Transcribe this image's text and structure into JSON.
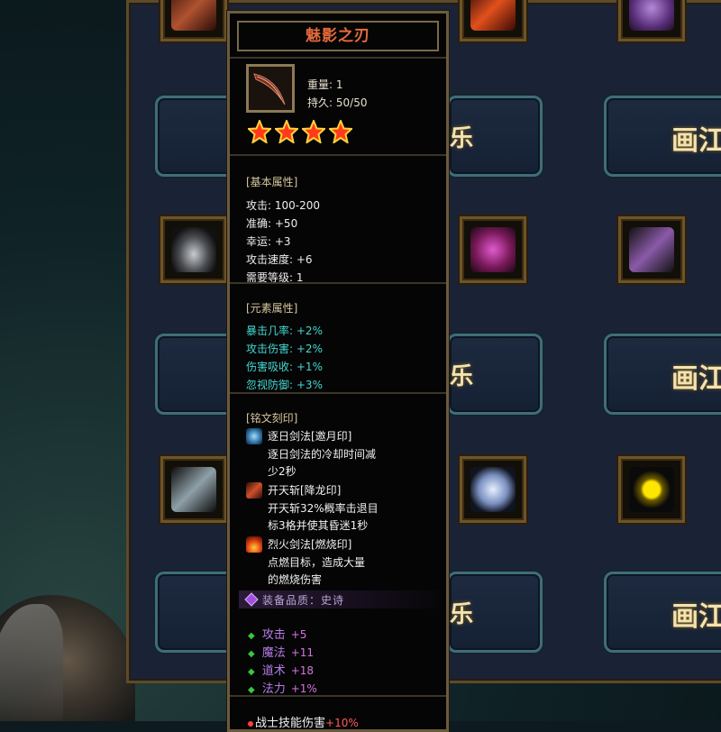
{
  "background": {
    "plaque_text": "画江",
    "plaque_fragment_left": "画",
    "plaque_fragment_right": "乐"
  },
  "tooltip": {
    "title": "魅影之刃",
    "weight_label": "重量:",
    "weight_value": "1",
    "durability_label": "持久:",
    "durability_value": "50/50",
    "star_count": 4,
    "basic": {
      "heading": "[基本属性]",
      "rows": [
        {
          "label": "攻击:",
          "value": "100-200"
        },
        {
          "label": "准确:",
          "value": "+50"
        },
        {
          "label": "幸运:",
          "value": "+3"
        },
        {
          "label": "攻击速度:",
          "value": "+6"
        },
        {
          "label": "需要等级:",
          "value": "1"
        }
      ]
    },
    "element": {
      "heading": "[元素属性]",
      "rows": [
        {
          "label": "暴击几率:",
          "value": "+2%"
        },
        {
          "label": "攻击伤害:",
          "value": "+2%"
        },
        {
          "label": "伤害吸收:",
          "value": "+1%"
        },
        {
          "label": "忽视防御:",
          "value": "+3%"
        }
      ]
    },
    "inscription": {
      "heading": "[铭文刻印]",
      "items": [
        {
          "icon": "moon-seal-icon",
          "name": "逐日剑法[邀月印]",
          "line1": "逐日剑法的冷却时间减",
          "line2": "少2秒"
        },
        {
          "icon": "dragon-seal-icon",
          "name": "开天斩[降龙印]",
          "line1": "开天斩32%概率击退目",
          "line2": "标3格并使其昏迷1秒"
        },
        {
          "icon": "fire-seal-icon",
          "name": "烈火剑法[燃烧印]",
          "line1": "点燃目标，造成大量",
          "line2": "的燃烧伤害"
        }
      ]
    },
    "quality": "装备品质：史诗",
    "bonuses": [
      {
        "label": "攻击",
        "value": "+5"
      },
      {
        "label": "魔法",
        "value": "+11"
      },
      {
        "label": "道术",
        "value": "+18"
      },
      {
        "label": "法力",
        "value": "+1%"
      }
    ],
    "skill_label": "战士技能伤害",
    "skill_value": "+10%"
  },
  "colors": {
    "title": "#e46a3c",
    "element_text": "#45d7d2",
    "bonus_label": "#b57ce8",
    "skill_value": "#ff5a5a"
  }
}
